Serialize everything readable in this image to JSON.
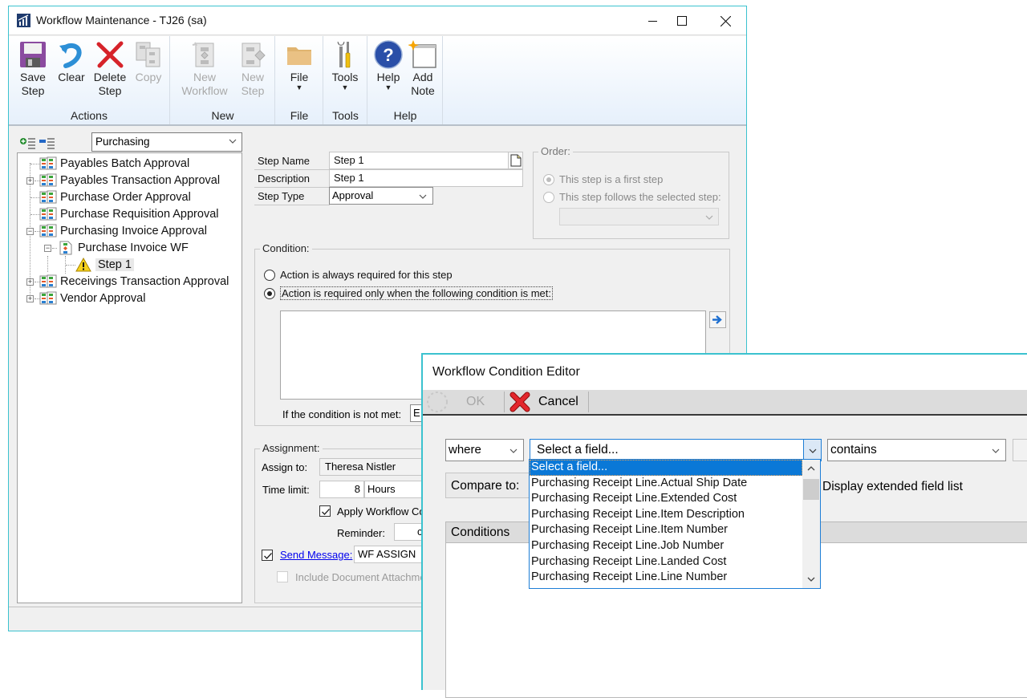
{
  "main_window": {
    "title": "Workflow Maintenance  -  TJ26 (sa)",
    "ribbon": {
      "groups": [
        {
          "label": "Actions",
          "buttons": [
            {
              "line1": "Save",
              "line2": "Step",
              "icon": "save-icon",
              "enabled": true
            },
            {
              "line1": "Clear",
              "line2": "",
              "icon": "undo-icon",
              "enabled": true
            },
            {
              "line1": "Delete",
              "line2": "Step",
              "icon": "delete-icon",
              "enabled": true
            },
            {
              "line1": "Copy",
              "line2": "",
              "icon": "copy-icon",
              "enabled": false
            }
          ]
        },
        {
          "label": "New",
          "buttons": [
            {
              "line1": "New",
              "line2": "Workflow",
              "icon": "new-workflow-icon",
              "enabled": false
            },
            {
              "line1": "New",
              "line2": "Step",
              "icon": "new-step-icon",
              "enabled": false
            }
          ]
        },
        {
          "label": "File",
          "buttons": [
            {
              "line1": "File",
              "line2": "▾",
              "icon": "folder-icon",
              "enabled": true
            }
          ]
        },
        {
          "label": "Tools",
          "buttons": [
            {
              "line1": "Tools",
              "line2": "▾",
              "icon": "tools-icon",
              "enabled": true
            }
          ]
        },
        {
          "label": "Help",
          "buttons": [
            {
              "line1": "Help",
              "line2": "▾",
              "icon": "help-icon",
              "enabled": true
            },
            {
              "line1": "Add",
              "line2": "Note",
              "icon": "note-icon",
              "enabled": true
            }
          ]
        }
      ]
    },
    "tree": {
      "series_select": "Purchasing",
      "nodes": [
        {
          "label": "Payables Batch Approval",
          "level": 0,
          "expander": "",
          "icon": "workflow-type-icon"
        },
        {
          "label": "Payables Transaction Approval",
          "level": 0,
          "expander": "+",
          "icon": "workflow-type-icon"
        },
        {
          "label": "Purchase Order Approval",
          "level": 0,
          "expander": "",
          "icon": "workflow-type-icon"
        },
        {
          "label": "Purchase Requisition Approval",
          "level": 0,
          "expander": "",
          "icon": "workflow-type-icon"
        },
        {
          "label": "Purchasing Invoice Approval",
          "level": 0,
          "expander": "−",
          "icon": "workflow-type-icon"
        },
        {
          "label": "Purchase Invoice WF",
          "level": 1,
          "expander": "−",
          "icon": "workflow-icon"
        },
        {
          "label": "Step 1",
          "level": 2,
          "expander": "",
          "icon": "warning-icon",
          "selected": true
        },
        {
          "label": "Receivings Transaction Approval",
          "level": 0,
          "expander": "+",
          "icon": "workflow-type-icon"
        },
        {
          "label": "Vendor Approval",
          "level": 0,
          "expander": "+",
          "icon": "workflow-type-icon"
        }
      ]
    },
    "form": {
      "step_name_label": "Step Name",
      "step_name_value": "Step 1",
      "description_label": "Description",
      "description_value": "Step 1",
      "step_type_label": "Step Type",
      "step_type_value": "Approval",
      "order": {
        "title": "Order:",
        "option_first": "This step is a first step",
        "option_follows": "This step follows the selected step:",
        "selected": "first",
        "follows_select_value": ""
      },
      "condition": {
        "title": "Condition:",
        "option_always": "Action is always required for this step",
        "option_conditional": "Action is required only when the following condition is met:",
        "selected": "conditional",
        "condition_text": "",
        "not_met_label": "If the condition is not met:",
        "not_met_value": "E"
      },
      "assignment": {
        "title": "Assignment:",
        "assign_to_label": "Assign to:",
        "assign_to_value": "Theresa Nistler",
        "time_limit_label": "Time limit:",
        "time_limit_value": "8",
        "time_limit_unit": "Hours",
        "apply_calendar_label": "Apply Workflow Co",
        "apply_calendar_checked": true,
        "reminder_label": "Reminder:",
        "reminder_value": "c",
        "send_message_checked": true,
        "send_message_label": "Send Message:",
        "send_message_value": "WF ASSIGN",
        "include_attachments_label": "Include Document Attachme",
        "include_attachments_checked": false
      }
    }
  },
  "condition_editor": {
    "title": "Workflow Condition Editor",
    "toolbar": {
      "ok_label": "OK",
      "ok_enabled": false,
      "cancel_label": "Cancel"
    },
    "where_value": "where",
    "field_value": "Select a field...",
    "operator_value": "contains",
    "compare_to_label": "Compare to:",
    "display_extended_label": "Display extended field list",
    "conditions_header": "Conditions",
    "field_options": [
      "Select a field...",
      "Purchasing Receipt Line.Actual Ship Date",
      "Purchasing Receipt Line.Extended Cost",
      "Purchasing Receipt Line.Item Description",
      "Purchasing Receipt Line.Item Number",
      "Purchasing Receipt Line.Job Number",
      "Purchasing Receipt Line.Landed Cost",
      "Purchasing Receipt Line.Line Number"
    ],
    "selected_option_index": 0
  },
  "colors": {
    "window_border": "#3bc2cf",
    "selection": "#0a78d7",
    "link": "#0000ee"
  }
}
